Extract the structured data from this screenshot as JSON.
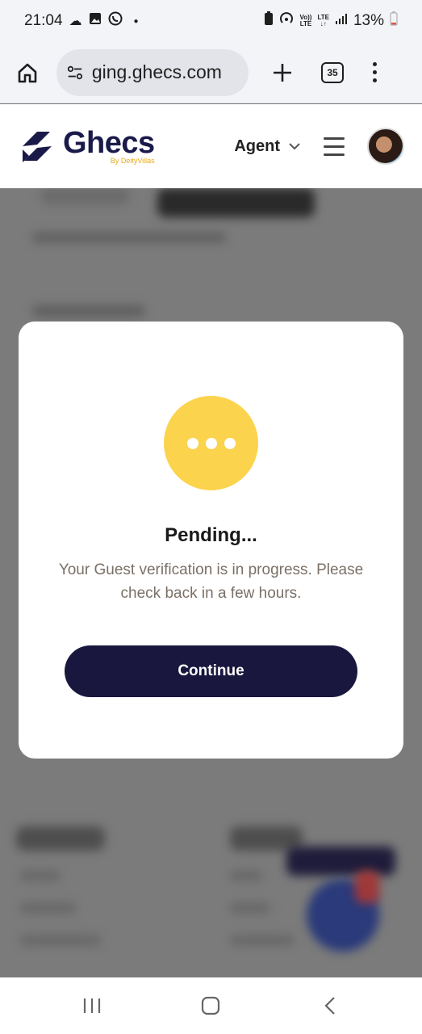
{
  "status_bar": {
    "time": "21:04",
    "battery": "13%",
    "volte_top": "Vo))",
    "volte_bottom": "LTE",
    "lte_top": "LTE",
    "lte_bottom": "↓↑"
  },
  "browser": {
    "url": "ging.ghecs.com",
    "tab_count": "35"
  },
  "header": {
    "logo_text": "Ghecs",
    "logo_sub": "By DeityVillas",
    "role_label": "Agent"
  },
  "modal": {
    "title": "Pending...",
    "message": "Your Guest verification is in progress. Please check back in a few hours.",
    "button_label": "Continue"
  },
  "colors": {
    "brand": "#19173e",
    "pending": "#fcd34d",
    "logo_accent": "#e9a91b"
  }
}
